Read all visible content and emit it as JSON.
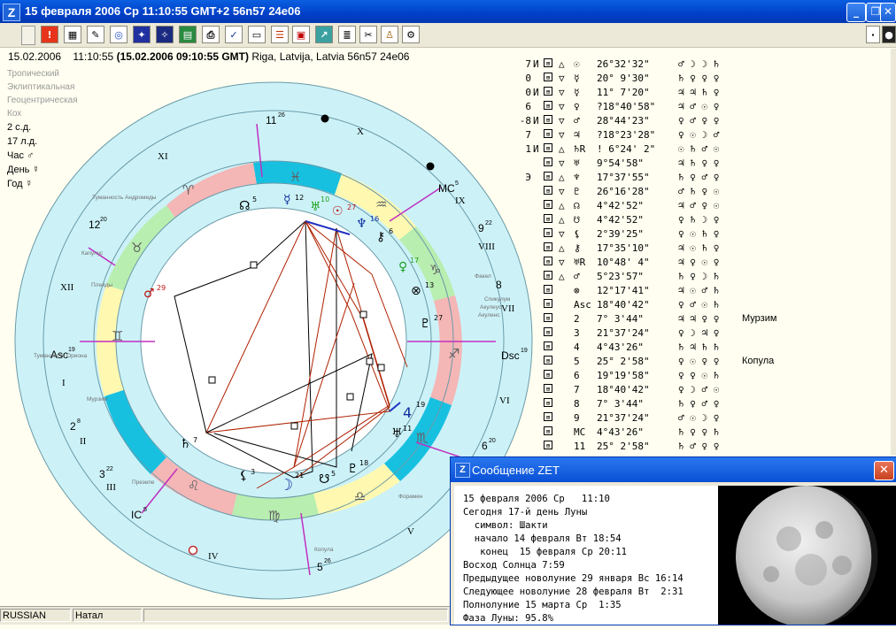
{
  "window": {
    "title": "15 февраля 2006  Ср   11:10:55 GMT+2 56n57  24e06",
    "logo": "Z",
    "minimize_icon": "_",
    "restore_icon": "❐",
    "close_icon": "✕"
  },
  "header": {
    "date": "15.02.2006",
    "time": "11:10:55",
    "gmt": "(15.02.2006  09:10:55 GMT)",
    "place": "Riga, Latvija, Latvia 56n57  24e06"
  },
  "left_panel": {
    "settings": [
      "Тропический",
      "Эклиптикальная",
      "Геоцентрическая",
      "Кох"
    ],
    "info": [
      "2 с.д.",
      "17 л.д.",
      "Час ♂",
      "День ☿",
      "Год ☿"
    ]
  },
  "chart": {
    "house_labels": [
      "I",
      "II",
      "III",
      "IV",
      "V",
      "VI",
      "VII",
      "VIII",
      "IX",
      "X",
      "XI",
      "XII"
    ],
    "cusp_labels": [
      {
        "name": "Asc",
        "deg": "19"
      },
      {
        "name": "2",
        "deg": "8"
      },
      {
        "name": "3",
        "deg": "22"
      },
      {
        "name": "IC",
        "deg": "5"
      },
      {
        "name": "5",
        "deg": "26"
      },
      {
        "name": "6",
        "deg": "20"
      },
      {
        "name": "Dsc",
        "deg": "19"
      },
      {
        "name": "8",
        "deg": ""
      },
      {
        "name": "9",
        "deg": "22"
      },
      {
        "name": "MC",
        "deg": "5"
      },
      {
        "name": "11",
        "deg": "26"
      },
      {
        "name": "12",
        "deg": "20"
      }
    ],
    "star_labels": [
      "Туманность Андромеды",
      "Капулус",
      "Плеяды",
      "Туманность Ориона",
      "Мурзим",
      "Презепе",
      "Копула",
      "Форамен",
      "Акуленс",
      "Спикулум",
      "Акулеус",
      "Факел"
    ],
    "signs": [
      "♈",
      "♉",
      "♊",
      "♋",
      "♌",
      "♍",
      "♎",
      "♏",
      "♐",
      "♑",
      "♒",
      "♓"
    ],
    "planets": [
      {
        "glyph": "☿",
        "deg": "12"
      },
      {
        "glyph": "♅",
        "deg": "10"
      },
      {
        "glyph": "☉",
        "deg": "27"
      },
      {
        "glyph": "♆",
        "deg": "16"
      },
      {
        "glyph": "⚷",
        "deg": "6"
      },
      {
        "glyph": "♀",
        "deg": "17"
      },
      {
        "glyph": "⊗",
        "deg": "13"
      },
      {
        "glyph": "♇",
        "deg": "27"
      },
      {
        "glyph": "4",
        "deg": "19"
      },
      {
        "glyph": "♄",
        "deg": "7"
      },
      {
        "glyph": "⚸",
        "deg": "3"
      },
      {
        "glyph": "☽",
        "deg": "21"
      },
      {
        "glyph": "☋",
        "deg": "5"
      },
      {
        "glyph": "♇",
        "deg": "18"
      },
      {
        "glyph": "☊",
        "deg": "5"
      },
      {
        "glyph": "♂",
        "deg": "29"
      },
      {
        "glyph": "♅",
        "deg": "11"
      }
    ]
  },
  "aspect_table": [
    {
      "num": "7",
      "mark": "И",
      "asp": "△",
      "planet": "☉",
      "pos": "26°32'32\"",
      "rulers": "♂ ☽ ☽ ♄",
      "note": ""
    },
    {
      "num": "0",
      "mark": "",
      "asp": "▽",
      "planet": "☿",
      "pos": "20° 9'30\"",
      "rulers": "♄ ♀ ♀ ♀",
      "note": ""
    },
    {
      "num": "0",
      "mark": "И",
      "asp": "▽",
      "planet": "☿",
      "pos": "11° 7'20\"",
      "rulers": "♃ ♃ ♄ ♀",
      "note": ""
    },
    {
      "num": "6",
      "mark": "",
      "asp": "▽",
      "planet": "♀",
      "pos": "?18°40'58\"",
      "rulers": "♃ ♂ ☉ ♀",
      "note": ""
    },
    {
      "num": "-8",
      "mark": "И",
      "asp": "▽",
      "planet": "♂",
      "pos": "28°44'23\"",
      "rulers": "♀ ♂ ♀ ♀",
      "note": ""
    },
    {
      "num": "7",
      "mark": "",
      "asp": "▽",
      "planet": "♃",
      "pos": "?18°23'28\"",
      "rulers": "♀ ☉ ☽ ♂",
      "note": ""
    },
    {
      "num": "1",
      "mark": "И",
      "asp": "△",
      "planet": "♄R",
      "pos": "! 6°24' 2\"",
      "rulers": "☉ ♄ ♂ ☉",
      "note": ""
    },
    {
      "num": "",
      "mark": "",
      "asp": "▽",
      "planet": "♅",
      "pos": "9°54'58\"",
      "rulers": "♃ ♄ ♀ ♀",
      "note": ""
    },
    {
      "num": "Э",
      "mark": "",
      "asp": "△",
      "planet": "♆",
      "pos": "17°37'55\"",
      "rulers": "♄ ♀ ♂ ♀",
      "note": ""
    },
    {
      "num": "",
      "mark": "",
      "asp": "▽",
      "planet": "♇",
      "pos": "26°16'28\"",
      "rulers": "♂ ♄ ♀ ☉",
      "note": ""
    },
    {
      "num": "",
      "mark": "",
      "asp": "△",
      "planet": "☊",
      "pos": "4°42'52\"",
      "rulers": "♃ ♂ ♀ ☉",
      "note": ""
    },
    {
      "num": "",
      "mark": "",
      "asp": "△",
      "planet": "☋",
      "pos": "4°42'52\"",
      "rulers": "♀ ♄ ☽ ♀",
      "note": ""
    },
    {
      "num": "",
      "mark": "",
      "asp": "▽",
      "planet": "⚸",
      "pos": "2°39'25\"",
      "rulers": "♀ ☉ ♄ ♀",
      "note": ""
    },
    {
      "num": "",
      "mark": "",
      "asp": "△",
      "planet": "⚷",
      "pos": "17°35'10\"",
      "rulers": "♃ ☉ ♄ ♀",
      "note": ""
    },
    {
      "num": "",
      "mark": "",
      "asp": "▽",
      "planet": "♅R",
      "pos": "10°48' 4\"",
      "rulers": "♃ ♀ ☉ ♀",
      "note": ""
    },
    {
      "num": "",
      "mark": "",
      "asp": "△",
      "planet": "♂",
      "pos": "5°23'57\"",
      "rulers": "♄ ♀ ☽ ♄",
      "note": ""
    },
    {
      "num": "",
      "mark": "",
      "asp": "",
      "planet": "⊗",
      "pos": "12°17'41\"",
      "rulers": "♃ ☉ ♂ ♄",
      "note": ""
    },
    {
      "num": "",
      "mark": "",
      "asp": "",
      "planet": "Asc",
      "pos": "18°40'42\"",
      "rulers": "♀ ♂ ☉ ♄",
      "note": ""
    },
    {
      "num": "",
      "mark": "",
      "asp": "",
      "planet": "2",
      "pos": "7° 3'44\"",
      "rulers": "♃ ♃ ♀ ♀",
      "note": "Мурзим"
    },
    {
      "num": "",
      "mark": "",
      "asp": "",
      "planet": "3",
      "pos": "21°37'24\"",
      "rulers": "♀ ☽ ♃ ♀",
      "note": ""
    },
    {
      "num": "",
      "mark": "",
      "asp": "",
      "planet": "4",
      "pos": "4°43'26\"",
      "rulers": "♄ ♃ ♄ ♄",
      "note": ""
    },
    {
      "num": "",
      "mark": "",
      "asp": "",
      "planet": "5",
      "pos": "25° 2'58\"",
      "rulers": "♀ ☉ ♀ ♀",
      "note": "Копула"
    },
    {
      "num": "",
      "mark": "",
      "asp": "",
      "planet": "6",
      "pos": "19°19'58\"",
      "rulers": "♀ ♀ ☉ ♄",
      "note": ""
    },
    {
      "num": "",
      "mark": "",
      "asp": "",
      "planet": "7",
      "pos": "18°40'42\"",
      "rulers": "♀ ☽ ♂ ☉",
      "note": ""
    },
    {
      "num": "",
      "mark": "",
      "asp": "",
      "planet": "8",
      "pos": "7° 3'44\"",
      "rulers": "♄ ♀ ♂ ♀",
      "note": ""
    },
    {
      "num": "",
      "mark": "",
      "asp": "",
      "planet": "9",
      "pos": "21°37'24\"",
      "rulers": "♂ ☉ ☽ ♀",
      "note": ""
    },
    {
      "num": "",
      "mark": "",
      "asp": "",
      "planet": "MC",
      "pos": "4°43'26\"",
      "rulers": "♄ ♀ ♀ ♄",
      "note": ""
    },
    {
      "num": "",
      "mark": "",
      "asp": "",
      "planet": "11",
      "pos": "25° 2'58\"",
      "rulers": "♄ ♂ ♀ ♀",
      "note": ""
    }
  ],
  "message": {
    "title": "Сообщение ZET",
    "lines": [
      "15 февраля 2006 Ср   11:10",
      "Сегодня 17-й день Луны",
      "  символ: Шакти",
      "  начало 14 февраля Вт 18:54",
      "   конец  15 февраля Ср 20:11",
      "Восход Солнца 7:59",
      "Предыдущее новолуние 29 января Вс 16:14",
      "Следующее новолуние 28 февраля Вт  2:31",
      "Полнолуние 15 марта Ср  1:35",
      "Фаза Луны: 95.8%"
    ],
    "moon_phase": 0.958,
    "close_icon": "✕"
  },
  "statusbar": {
    "language": "RUSSIAN",
    "mode": "Натал"
  },
  "toolbar_icons": [
    "alert-icon",
    "table-icon",
    "brush-icon",
    "wheel-icon",
    "star-map-icon",
    "galaxy-icon",
    "map-icon",
    "print-preview-icon",
    "select-icon",
    "window-icon",
    "list-icon",
    "calendar-icon",
    "chart-icon",
    "notes-icon",
    "tools-icon",
    "user-icon",
    "settings-icon"
  ]
}
